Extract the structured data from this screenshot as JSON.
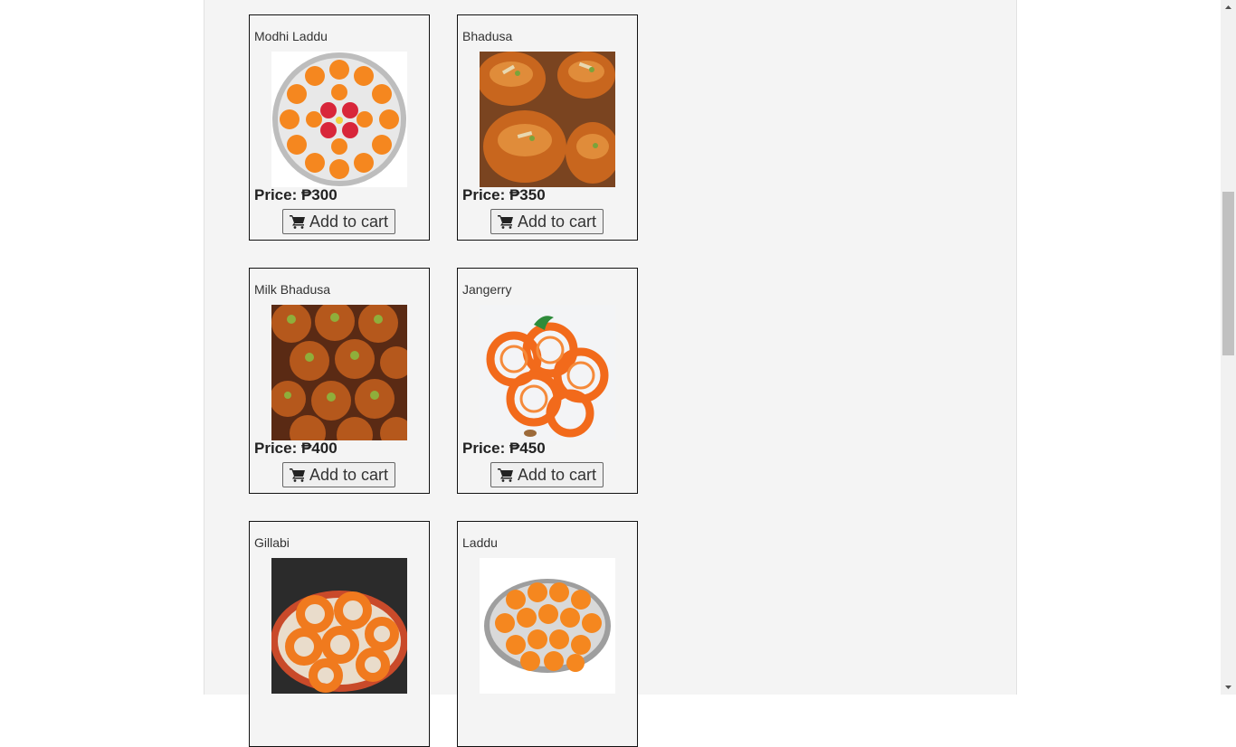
{
  "products": [
    {
      "name": "Modhi Laddu",
      "price": "Price: ₱300",
      "button": "Add to cart",
      "image": "modhi-laddu-image"
    },
    {
      "name": "Bhadusa",
      "price": "Price: ₱350",
      "button": "Add to cart",
      "image": "bhadusa-image"
    },
    {
      "name": "Milk Bhadusa",
      "price": "Price: ₱400",
      "button": "Add to cart",
      "image": "milk-bhadusa-image"
    },
    {
      "name": "Jangerry",
      "price": "Price: ₱450",
      "button": "Add to cart",
      "image": "jangerry-image"
    },
    {
      "name": "Gillabi",
      "price": "",
      "button": "",
      "image": "gillabi-image"
    },
    {
      "name": "Laddu",
      "price": "",
      "button": "",
      "image": "laddu-image"
    }
  ],
  "icons": {
    "cart": "shopping-cart-icon"
  },
  "colors": {
    "page_bg": "#ffffff",
    "content_bg": "#f4f4f4",
    "border": "#111111",
    "laddu_orange": "#f5871f"
  }
}
